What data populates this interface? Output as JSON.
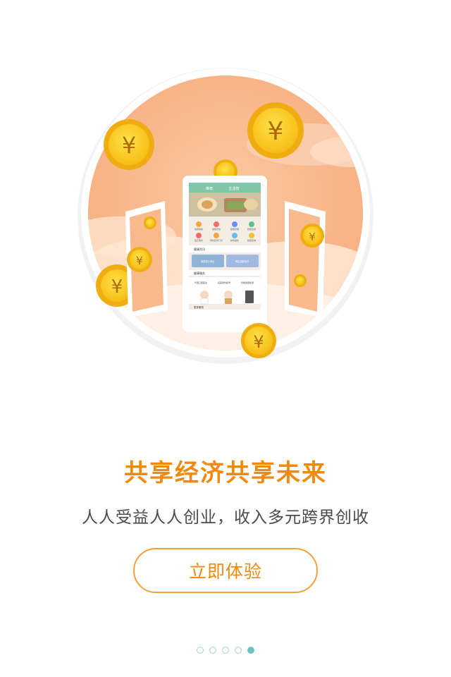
{
  "hero": {
    "illustration": "phones-and-yuan-coins",
    "phone_screen": {
      "tabs": [
        "推荐",
        "生活馆"
      ],
      "grid_items": [
        "健康档案",
        "健康评估",
        "慢病管理",
        "健康监测",
        "医疗服务",
        "预约挂号门诊",
        "体检报告",
        "健康咨询"
      ],
      "section_news": "健康资讯",
      "news_cards": [
        "健康重大消息",
        "养生保健知识"
      ],
      "section_services": "健康服务",
      "service_cards": [
        "华西口腔医生",
        "名医预约挂号",
        "智能健康检测"
      ],
      "section_more": "更多服务"
    },
    "coin_symbol": "¥",
    "colors": {
      "circle": "#f8b98c",
      "coin": "#fcc91a",
      "coin_inner": "#f0ad12",
      "phone_header": "#7fc7a8"
    }
  },
  "title": "共享经济共享未来",
  "subtitle": "人人受益人人创业，收入多元跨界创收",
  "cta_button": "立即体验",
  "pagination": {
    "total": 5,
    "active_index": 4
  },
  "colors": {
    "accent": "#f08a0c",
    "dot_active": "#6fc0c3",
    "dot_inactive": "#9fd3d6"
  }
}
